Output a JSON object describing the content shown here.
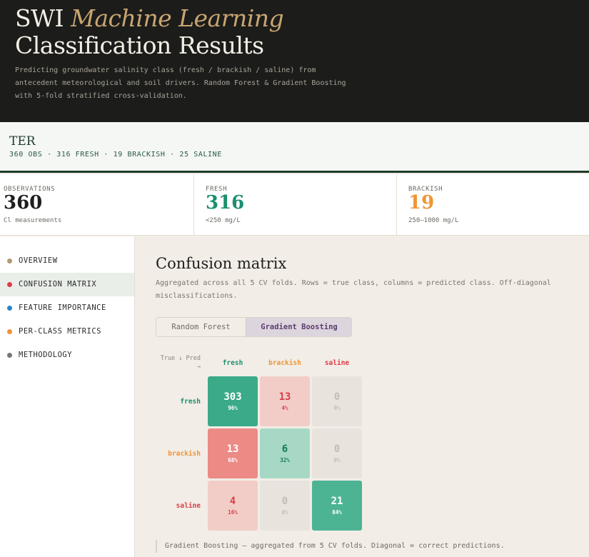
{
  "header": {
    "title_prefix": "SWI",
    "title_accent": "Machine Learning",
    "title_line2": "Classification Results",
    "subtitle": "Predicting groundwater salinity class (fresh / brackish / saline) from antecedent meteorological and soil drivers. Random Forest & Gradient Boosting with 5-fold stratified cross-validation."
  },
  "site": {
    "name": "TER",
    "meta": "360 OBS · 316 FRESH · 19 BRACKISH · 25 SALINE"
  },
  "stats": [
    {
      "label": "OBSERVATIONS",
      "value": "360",
      "note": "Cl measurements",
      "color": "#1e1e1e"
    },
    {
      "label": "FRESH",
      "value": "316",
      "note": "<250 mg/L",
      "color": "#1a8f6e"
    },
    {
      "label": "BRACKISH",
      "value": "19",
      "note": "250–1000 mg/L",
      "color": "#ef9536"
    }
  ],
  "sidebar": {
    "items": [
      {
        "label": "OVERVIEW",
        "color": "#b59a6e",
        "active": false
      },
      {
        "label": "CONFUSION MATRIX",
        "color": "#e03a47",
        "active": true
      },
      {
        "label": "FEATURE IMPORTANCE",
        "color": "#2a86c8",
        "active": false
      },
      {
        "label": "PER-CLASS METRICS",
        "color": "#ef9536",
        "active": false
      },
      {
        "label": "METHODOLOGY",
        "color": "#777777",
        "active": false
      }
    ]
  },
  "main": {
    "title": "Confusion matrix",
    "description": "Aggregated across all 5 CV folds. Rows = true class, columns = predicted class. Off-diagonal misclassifications.",
    "tabs": [
      {
        "label": "Random Forest",
        "active": false
      },
      {
        "label": "Gradient Boosting",
        "active": true
      }
    ],
    "footnote": "Gradient Boosting — aggregated from 5 CV folds. Diagonal = correct predictions."
  },
  "matrix": {
    "corner_line1": "True ↓ Pred",
    "corner_line2": "→",
    "classes": [
      {
        "name": "fresh",
        "color": "#1a8f6e"
      },
      {
        "name": "brackish",
        "color": "#ef9536"
      },
      {
        "name": "saline",
        "color": "#e03a47"
      }
    ],
    "rows": [
      [
        {
          "count": "303",
          "pct": "96%",
          "bg": "#3aaa88",
          "fg": "#ffffff"
        },
        {
          "count": "13",
          "pct": "4%",
          "bg": "#f2cdc8",
          "fg": "#d9404a"
        },
        {
          "count": "0",
          "pct": "0%",
          "bg": "#e8e3dd",
          "fg": "#c3bdb5"
        }
      ],
      [
        {
          "count": "13",
          "pct": "68%",
          "bg": "#ec8a86",
          "fg": "#ffffff"
        },
        {
          "count": "6",
          "pct": "32%",
          "bg": "#a6d8c5",
          "fg": "#15775a"
        },
        {
          "count": "0",
          "pct": "0%",
          "bg": "#e8e3dd",
          "fg": "#c3bdb5"
        }
      ],
      [
        {
          "count": "4",
          "pct": "16%",
          "bg": "#f2cdc8",
          "fg": "#d9404a"
        },
        {
          "count": "0",
          "pct": "0%",
          "bg": "#e8e3dd",
          "fg": "#c3bdb5"
        },
        {
          "count": "21",
          "pct": "84%",
          "bg": "#4db493",
          "fg": "#ffffff"
        }
      ]
    ]
  }
}
